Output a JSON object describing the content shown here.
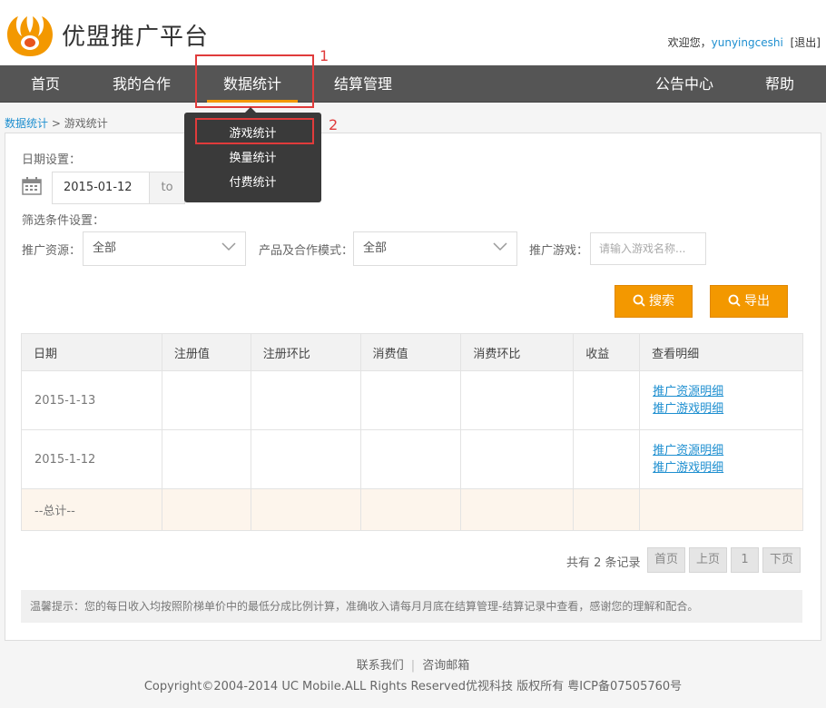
{
  "header": {
    "logo_text": "优盟推广平台",
    "welcome": "欢迎您，",
    "username": "yunyingceshi",
    "logout": "[退出]"
  },
  "nav": {
    "items": [
      "首页",
      "我的合作",
      "数据统计",
      "结算管理",
      "公告中心",
      "帮助"
    ],
    "active": "数据统计"
  },
  "annotations": {
    "one": "1",
    "two": "2"
  },
  "dropdown": {
    "items": [
      "游戏统计",
      "换量统计",
      "付费统计"
    ]
  },
  "breadcrumb": {
    "root": "数据统计",
    "separator": " > ",
    "current": "游戏统计"
  },
  "filters": {
    "date_label": "日期设置：",
    "start_date": "2015-01-12",
    "to": "to",
    "condition_label": "筛选条件设置：",
    "source_label": "推广资源：",
    "source_value": "全部",
    "product_label": "产品及合作模式：",
    "product_value": "全部",
    "game_label": "推广游戏：",
    "game_placeholder": "请输入游戏名称..."
  },
  "buttons": {
    "search": "搜索",
    "export": "导出"
  },
  "table": {
    "headers": [
      "日期",
      "注册值",
      "注册环比",
      "消费值",
      "消费环比",
      "收益",
      "查看明细"
    ],
    "rows": [
      {
        "date": "2015-1-13",
        "link1": "推广资源明细",
        "link2": "推广游戏明细"
      },
      {
        "date": "2015-1-12",
        "link1": "推广资源明细",
        "link2": "推广游戏明细"
      }
    ],
    "total_label": "--总计--"
  },
  "pagination": {
    "records": "共有 2 条记录",
    "first": "首页",
    "prev": "上页",
    "page": "1",
    "next": "下页"
  },
  "tip": "温馨提示：您的每日收入均按照阶梯单价中的最低分成比例计算，准确收入请每月月底在结算管理-结算记录中查看，感谢您的理解和配合。",
  "footer": {
    "contact": "联系我们",
    "sep": "|",
    "email": "咨询邮箱",
    "copyright": "Copyright©2004-2014 UC Mobile.ALL Rights Reserved优视科技 版权所有 粤ICP备07505760号"
  },
  "colors": {
    "accent": "#f39800",
    "nav_bg": "#555555",
    "link": "#1e8fd0",
    "highlight": "#e03b3b"
  }
}
